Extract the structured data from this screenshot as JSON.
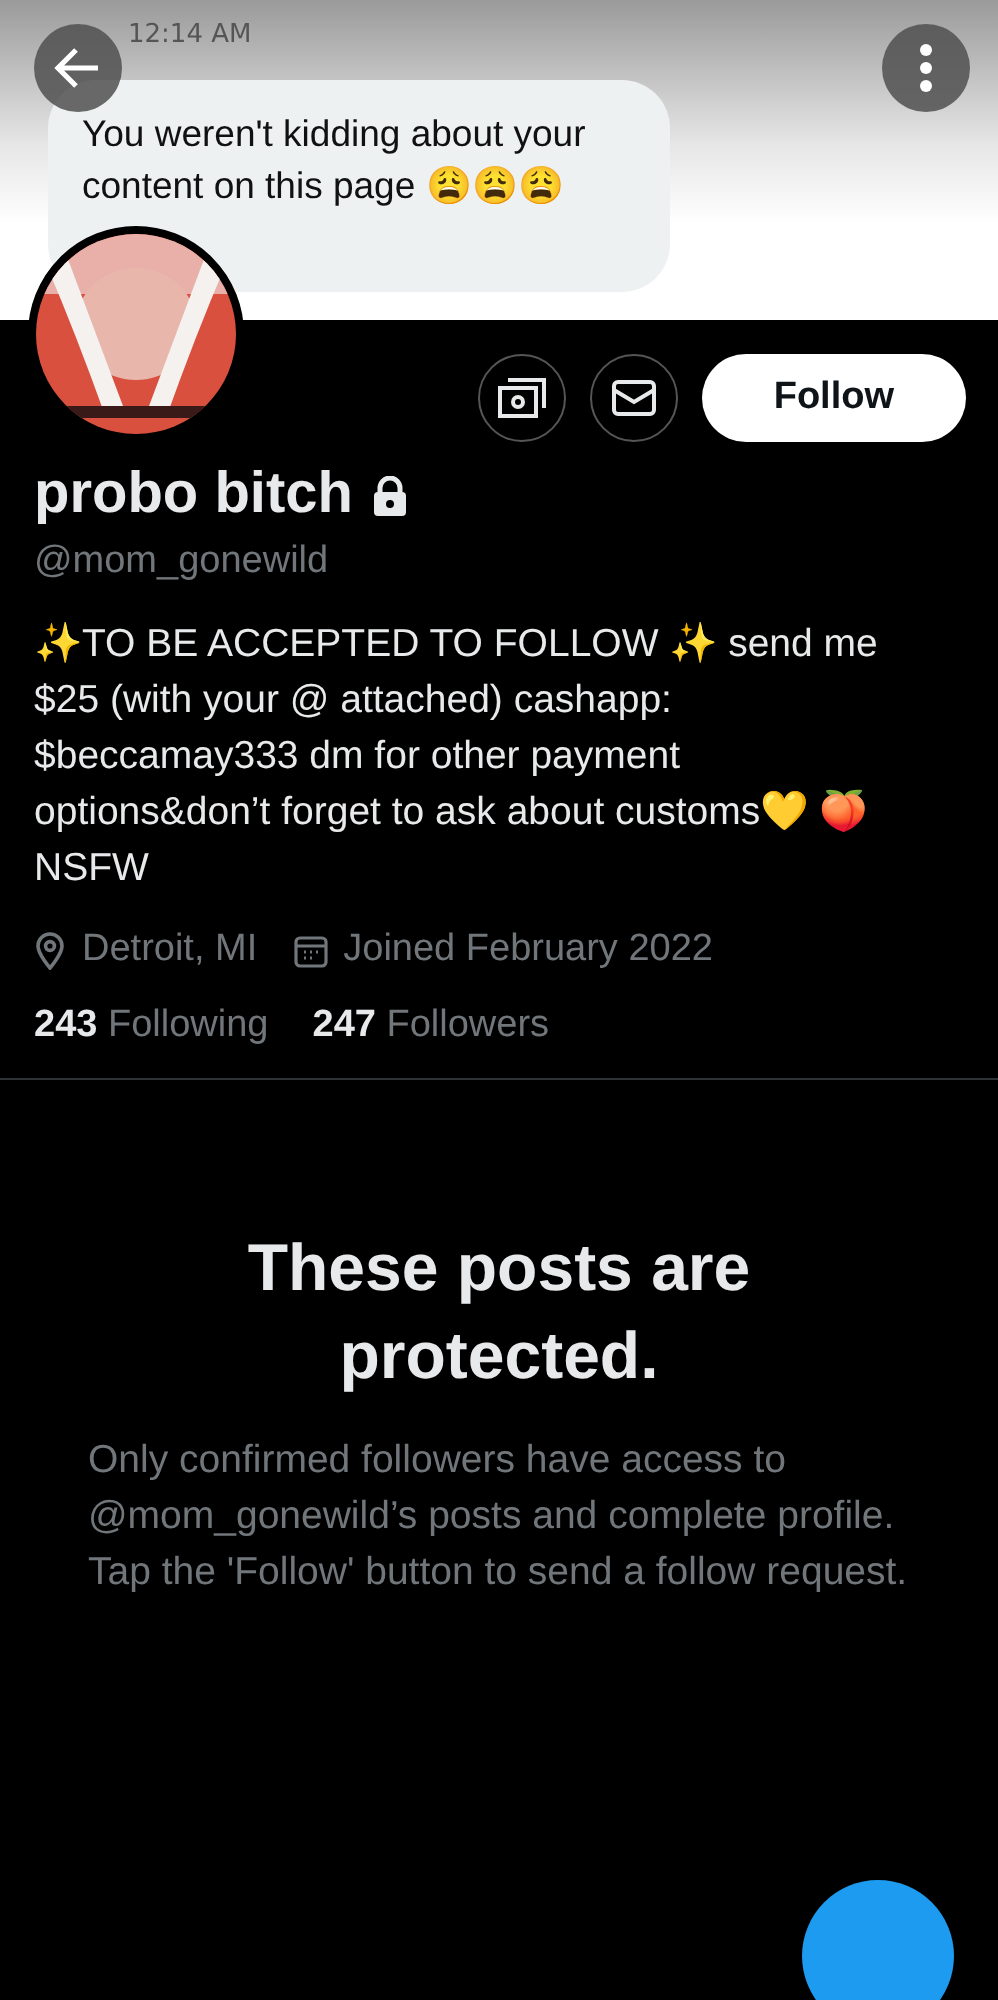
{
  "banner": {
    "time": "12:14 AM",
    "message": "You weren't kidding about your content on this page 😩😩😩"
  },
  "profile": {
    "name": "probo bitch",
    "locked": true,
    "handle": "@mom_gonewild",
    "bio": "✨TO BE ACCEPTED TO FOLLOW ✨ send me $25 (with your @ attached) cashapp: $beccamay333 dm for other payment options&don’t forget to ask about customs💛 🍑 NSFW",
    "location": "Detroit, MI",
    "joined": "Joined February 2022",
    "following_count": "243",
    "following_label": "Following",
    "followers_count": "247",
    "followers_label": "Followers"
  },
  "actions": [
    {
      "kind": "tip"
    },
    {
      "kind": "message"
    },
    {
      "kind": "follow",
      "label": "Follow"
    }
  ],
  "protected": {
    "title": "These posts are protected.",
    "body": "Only confirmed followers have access to @mom_gonewild’s posts and complete profile. Tap the 'Follow' button to send a follow request."
  }
}
